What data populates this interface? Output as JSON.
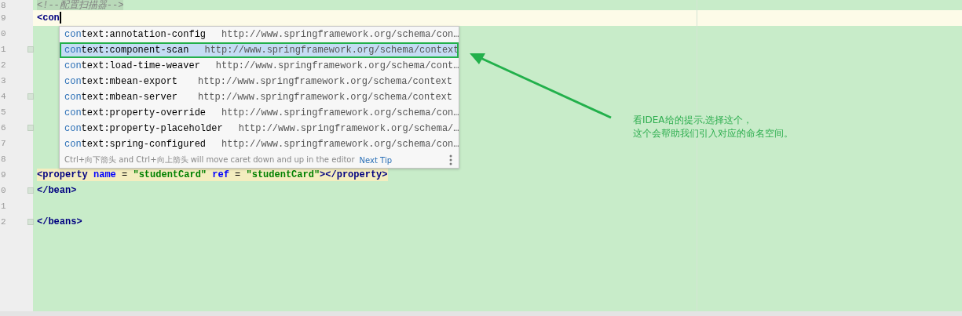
{
  "editor": {
    "lines": [
      {
        "number": "8",
        "current": false,
        "matched": false,
        "fold": false,
        "tokens": [
          {
            "kind": "comment",
            "text": "    <!--配置扫描器-->"
          }
        ]
      },
      {
        "number": "9",
        "current": true,
        "matched": false,
        "fold": false,
        "caret": true,
        "tokens": [
          {
            "kind": "tag",
            "text": "    <con"
          }
        ]
      },
      {
        "number": "0",
        "current": false,
        "fold": false
      },
      {
        "number": "1",
        "current": false,
        "fold": true
      },
      {
        "number": "2",
        "current": false,
        "fold": false
      },
      {
        "number": "3",
        "current": false,
        "fold": false
      },
      {
        "number": "4",
        "current": false,
        "fold": true
      },
      {
        "number": "5",
        "current": false,
        "fold": false
      },
      {
        "number": "6",
        "current": false,
        "fold": true
      },
      {
        "number": "7",
        "current": false,
        "fold": false
      },
      {
        "number": "8",
        "current": false,
        "fold": false
      },
      {
        "number": "9",
        "current": false,
        "matched": true,
        "fold": false,
        "tokens": [
          {
            "kind": "tag",
            "text": "        <property "
          },
          {
            "kind": "attr",
            "text": "name"
          },
          {
            "kind": "plain",
            "text": " = "
          },
          {
            "kind": "value",
            "text": "\"studentCard\""
          },
          {
            "kind": "attr",
            "text": " ref"
          },
          {
            "kind": "plain",
            "text": " = "
          },
          {
            "kind": "value",
            "text": "\"studentCard\""
          },
          {
            "kind": "tag",
            "text": "></property>"
          }
        ]
      },
      {
        "number": "0",
        "current": false,
        "matched": false,
        "fold": true,
        "tokens": [
          {
            "kind": "tag",
            "text": "    </bean>"
          }
        ]
      },
      {
        "number": "1",
        "current": false,
        "fold": false
      },
      {
        "number": "2",
        "current": false,
        "matched": false,
        "fold": true,
        "tokens": [
          {
            "kind": "tag",
            "text": "</beans>"
          }
        ]
      }
    ]
  },
  "completion_popup": {
    "items": [
      {
        "prefix": "con",
        "rest": "text:annotation-config",
        "url": "http://www.springframework.org/schema/con…",
        "selected": false
      },
      {
        "prefix": "con",
        "rest": "text:component-scan",
        "url": "http://www.springframework.org/schema/context",
        "selected": true
      },
      {
        "prefix": "con",
        "rest": "text:load-time-weaver",
        "url": "http://www.springframework.org/schema/cont…",
        "selected": false
      },
      {
        "prefix": "con",
        "rest": "text:mbean-export",
        "url": "http://www.springframework.org/schema/context",
        "selected": false
      },
      {
        "prefix": "con",
        "rest": "text:mbean-server",
        "url": "http://www.springframework.org/schema/context",
        "selected": false
      },
      {
        "prefix": "con",
        "rest": "text:property-override",
        "url": "http://www.springframework.org/schema/con…",
        "selected": false
      },
      {
        "prefix": "con",
        "rest": "text:property-placeholder",
        "url": "http://www.springframework.org/schema/…",
        "selected": false
      },
      {
        "prefix": "con",
        "rest": "text:spring-configured",
        "url": "http://www.springframework.org/schema/con…",
        "selected": false
      }
    ],
    "footer": {
      "hint": "Ctrl+向下箭头 and Ctrl+向上箭头 will move caret down and up in the editor",
      "link": "Next Tip"
    }
  },
  "annotation": {
    "lines": [
      "看IDEA给的提示,选择这个，",
      "这个会帮助我们引入对应的命名空间。"
    ]
  }
}
